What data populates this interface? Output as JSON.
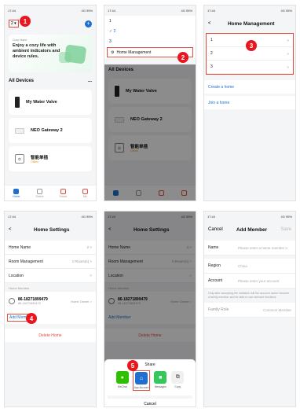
{
  "status_time": "17:44",
  "status_right": "4G 95%",
  "steps": [
    "1",
    "2",
    "3",
    "4",
    "5"
  ],
  "s1": {
    "banner_small": "Cozy Home",
    "banner_text": "Enjoy a cozy life with ambient indicators and device rules.",
    "section": "All Devices",
    "more": "...",
    "devices": [
      "My Water Valve",
      "NEO Gateway 2",
      "智能单插"
    ],
    "offline": "Offline",
    "tabs": [
      "Home",
      "Scene",
      "Smart",
      "Me"
    ]
  },
  "s2": {
    "homes": [
      "1",
      "2",
      "3"
    ],
    "management": "Home Management"
  },
  "s3": {
    "title": "Home Management",
    "homes": [
      "1",
      "2",
      "3"
    ],
    "create": "Create a home",
    "join": "Join a home"
  },
  "s4": {
    "title": "Home Settings",
    "rows": [
      {
        "k": "Home Name",
        "v": "2"
      },
      {
        "k": "Room Management",
        "v": "0 Room(s)"
      },
      {
        "k": "Location",
        "v": ""
      }
    ],
    "member_label": "Home Member",
    "member_name": "86-18271899479",
    "member_sub": "86-18271899479",
    "member_role": "Home Owner",
    "add": "Add Member",
    "delete": "Delete Home"
  },
  "s5": {
    "share_title": "Share",
    "apps": [
      "WeChat",
      "App Account",
      "Messages",
      "Copy"
    ],
    "cancel": "Cancel"
  },
  "s6": {
    "cancel": "Cancel",
    "title": "Add Member",
    "save": "Save",
    "rows": [
      {
        "k": "Name",
        "v": "Please enter a home member n"
      },
      {
        "k": "Region",
        "v": "China"
      },
      {
        "k": "Account",
        "v": "Please enter your account"
      }
    ],
    "note": "Only after accepting the invitation will the account owner become a family member and be able to use relevant functions.",
    "role_k": "Family Role",
    "role_v": "Common Member"
  }
}
